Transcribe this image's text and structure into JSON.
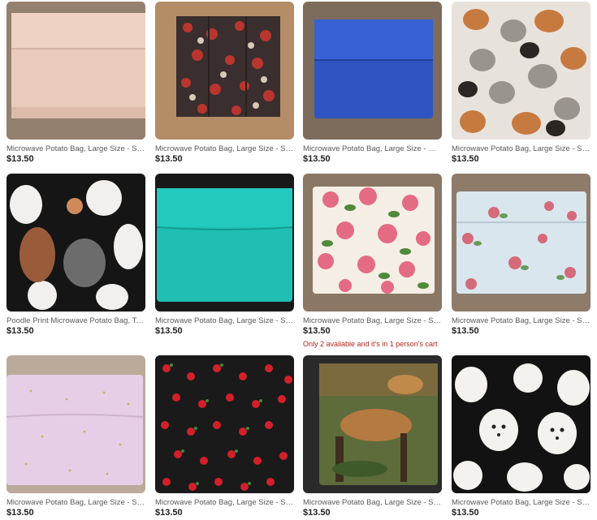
{
  "listings": [
    {
      "title": "Microwave Potato Bag, Large Size - Solid",
      "price": "$13.50",
      "image": "solid-peach-bag",
      "stock_note": ""
    },
    {
      "title": "Microwave Potato Bag, Large Size - Sp...",
      "price": "$13.50",
      "image": "chicken-print-bag",
      "stock_note": ""
    },
    {
      "title": "Microwave Potato Bag, Large Size - Mi...",
      "price": "$13.50",
      "image": "royal-blue-bag",
      "stock_note": ""
    },
    {
      "title": "Microwave Potato Bag, Large Size - Sp...",
      "price": "$13.50",
      "image": "cat-print-bag",
      "stock_note": ""
    },
    {
      "title": "Poodle Print Microwave Potato Bag, Tor...",
      "price": "$13.50",
      "image": "poodle-print-bag",
      "stock_note": ""
    },
    {
      "title": "Microwave Potato Bag, Large Size - Sp...",
      "price": "$13.50",
      "image": "turquoise-bag",
      "stock_note": ""
    },
    {
      "title": "Microwave Potato Bag, Large Size - Sp...",
      "price": "$13.50",
      "image": "pink-rose-bag",
      "stock_note": "Only 2 available and it's in 1 person's cart"
    },
    {
      "title": "Microwave Potato Bag, Large Size - Sp...",
      "price": "$13.50",
      "image": "rose-on-blue-bag",
      "stock_note": ""
    },
    {
      "title": "Microwave Potato Bag, Large Size - Sp...",
      "price": "$13.50",
      "image": "lavender-bag",
      "stock_note": ""
    },
    {
      "title": "Microwave Potato Bag, Large Size - Sp...",
      "price": "$13.50",
      "image": "cherry-print-bag",
      "stock_note": ""
    },
    {
      "title": "Microwave Potato Bag, Large Size - Sp...",
      "price": "$13.50",
      "image": "cougar-print-bag",
      "stock_note": ""
    },
    {
      "title": "Microwave Potato Bag, Large Size - Sp...",
      "price": "$13.50",
      "image": "bichon-print-bag",
      "stock_note": ""
    }
  ],
  "colors": {
    "price": "#222222",
    "title": "#595959",
    "stock_warning": "#b3261e",
    "wood_background": "#8a7360"
  }
}
